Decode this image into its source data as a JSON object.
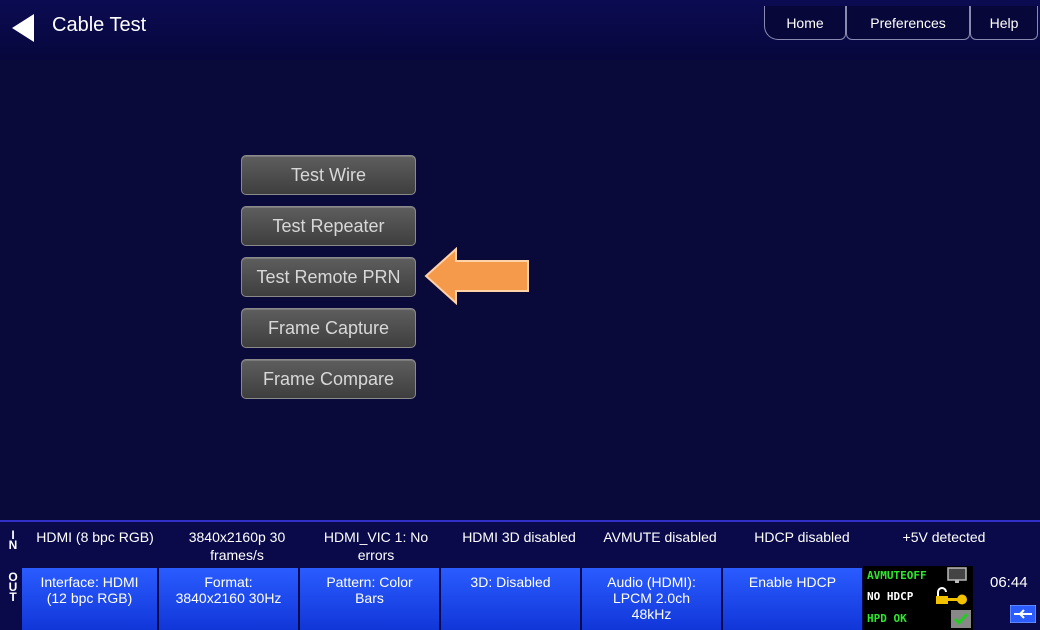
{
  "header": {
    "title": "Cable Test",
    "tabs": [
      "Home",
      "Preferences",
      "Help"
    ]
  },
  "menu": {
    "buttons": [
      "Test Wire",
      "Test Repeater",
      "Test Remote PRN",
      "Frame Capture",
      "Frame Compare"
    ]
  },
  "in_status": {
    "label": "IN",
    "items": [
      "HDMI (8 bpc RGB)",
      "3840x2160p 30 frames/s",
      "HDMI_VIC 1: No errors",
      "HDMI 3D disabled",
      "AVMUTE disabled",
      "HDCP disabled",
      "+5V detected"
    ]
  },
  "out_status": {
    "label": "OUT",
    "buttons": [
      "Interface: HDMI (12 bpc RGB)",
      "Format: 3840x2160 30Hz",
      "Pattern: Color Bars",
      "3D: Disabled",
      "Audio (HDMI): LPCM 2.0ch 48kHz",
      "Enable HDCP"
    ]
  },
  "status_panel": {
    "avmute": "AVMUTEOFF",
    "hdcp": "NO HDCP",
    "hpd": "HPD OK"
  },
  "clock": "06:44",
  "colors": {
    "background": "#0a0a3a",
    "out_button": "#1f48f0",
    "arrow": "#f59a4a",
    "status_green": "#2ee82e"
  },
  "icons": [
    "back-arrow-icon",
    "pointer-arrow-icon",
    "monitor-icon",
    "key-lock-icon",
    "checkbox-icon",
    "connector-icon"
  ]
}
